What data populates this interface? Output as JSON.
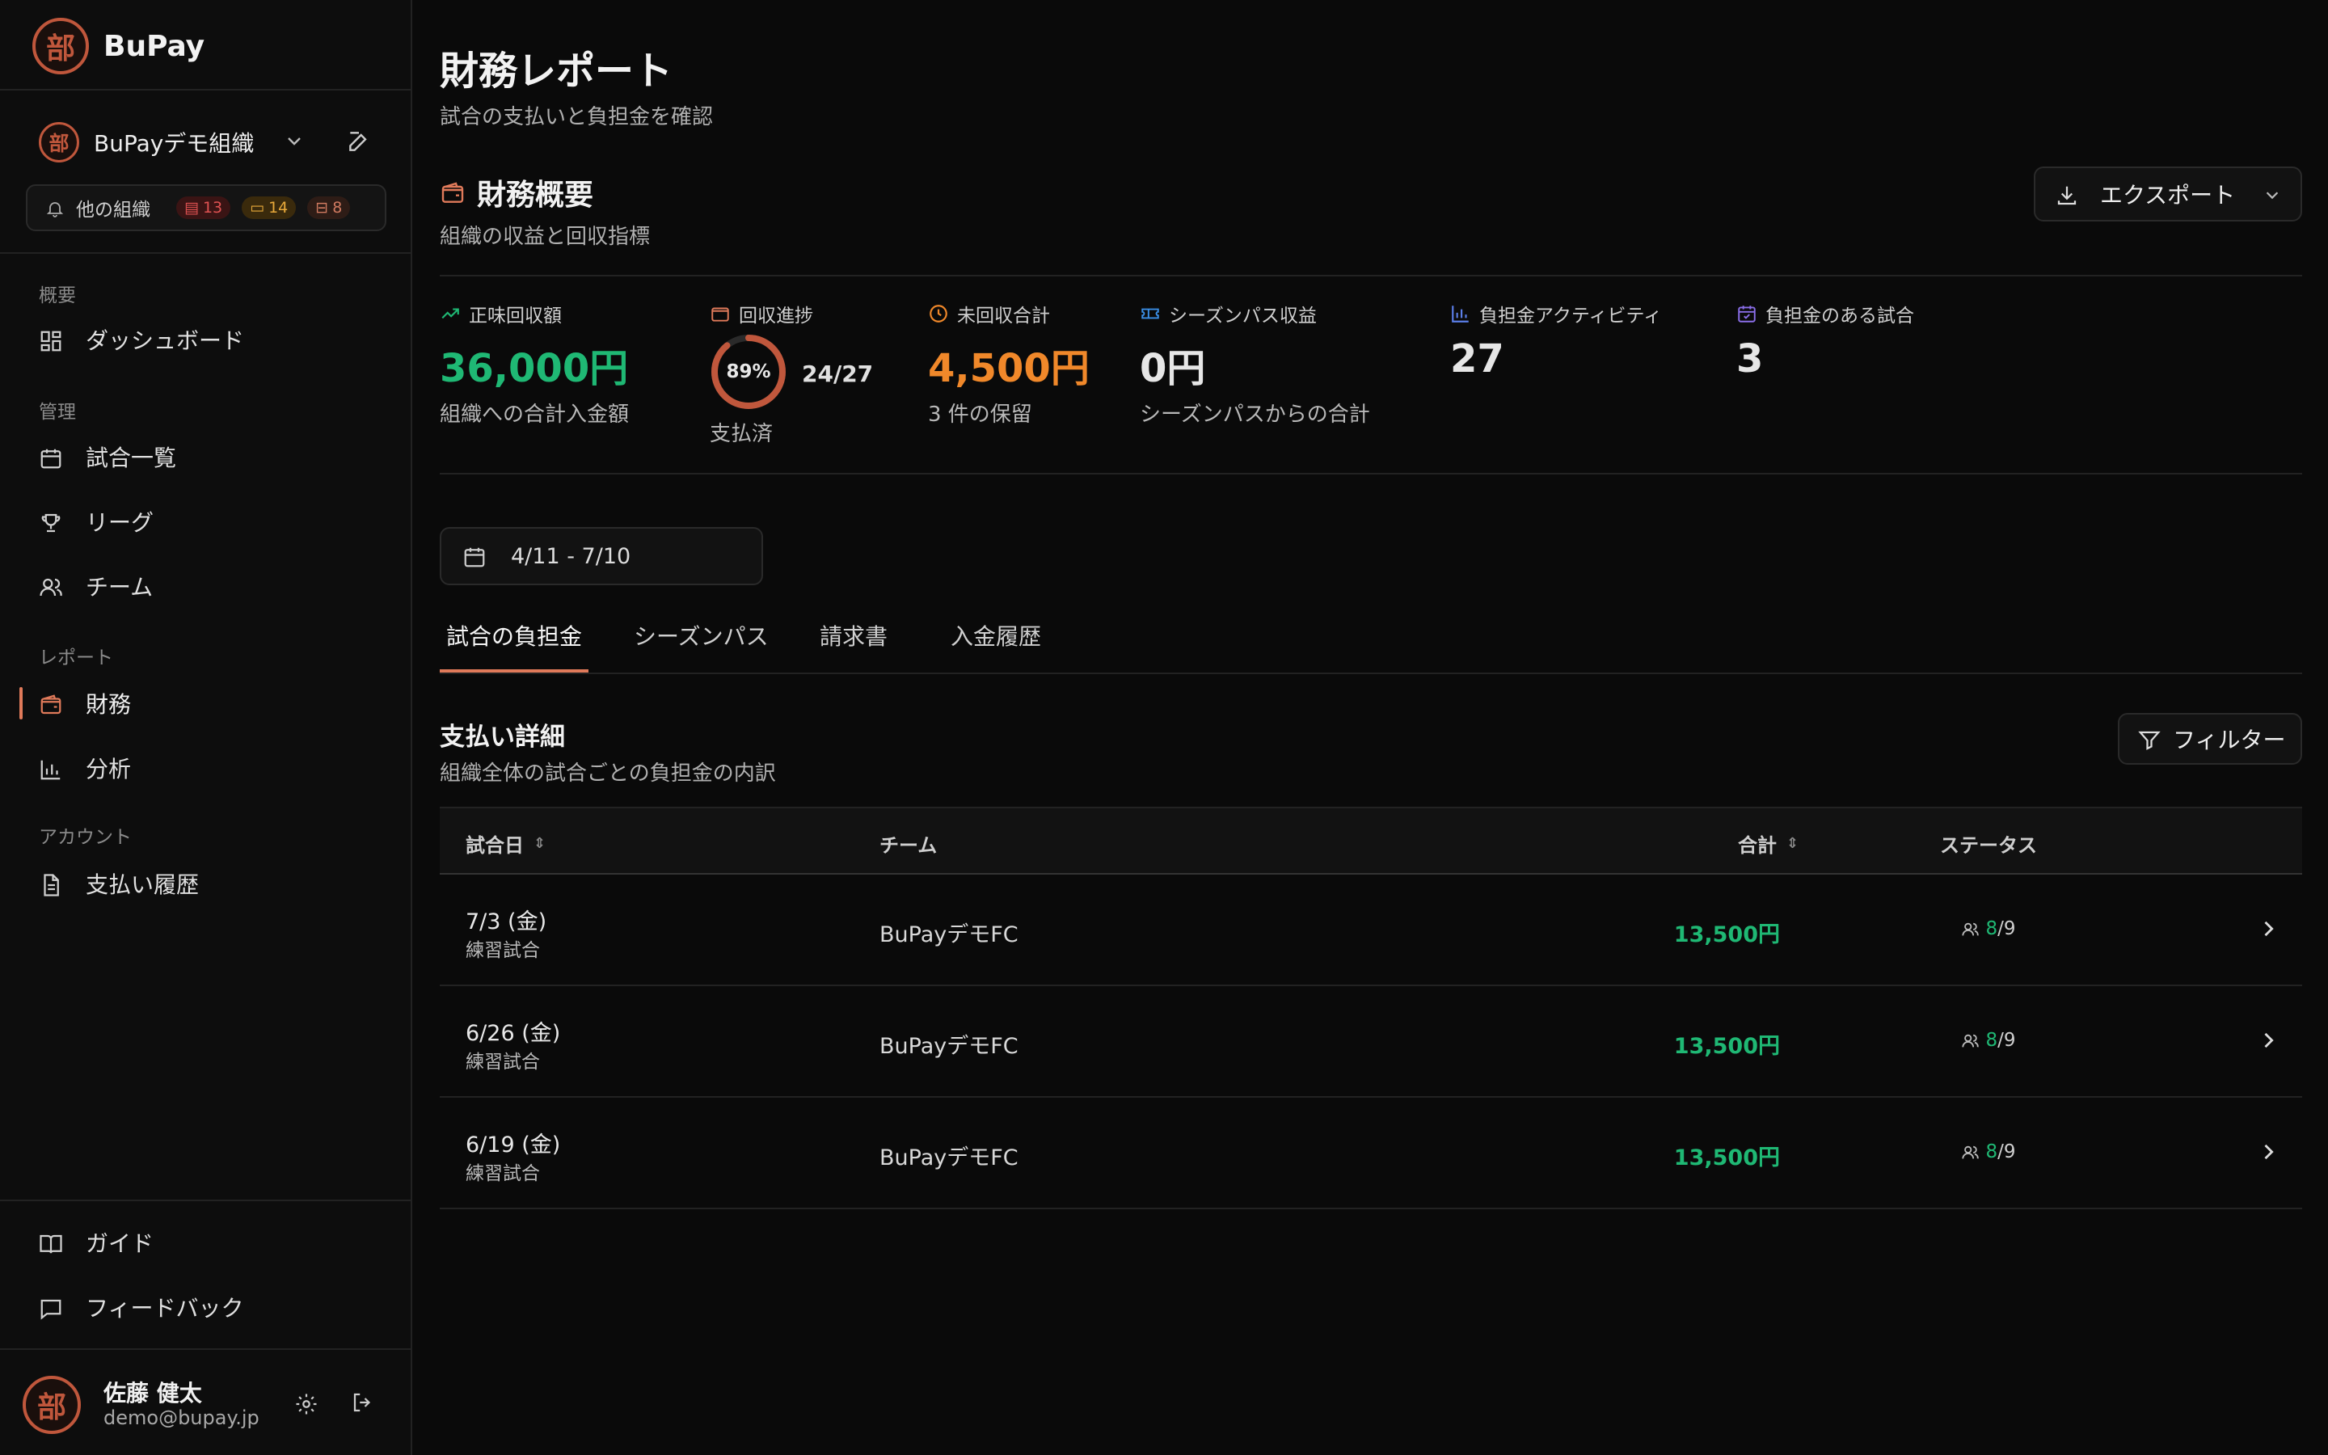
{
  "app": {
    "brand": "BuPay",
    "logo_char": "部"
  },
  "org": {
    "name": "BuPayデモ組織"
  },
  "other_orgs": {
    "label": "他の組織",
    "badges": {
      "red": "13",
      "amber": "14",
      "brown": "8"
    }
  },
  "sidebar": {
    "sections": {
      "overview": "概要",
      "manage": "管理",
      "report": "レポート",
      "account": "アカウント"
    },
    "items": {
      "dashboard": "ダッシュボード",
      "matches": "試合一覧",
      "leagues": "リーグ",
      "teams": "チーム",
      "finance": "財務",
      "analytics": "分析",
      "payments": "支払い履歴",
      "guide": "ガイド",
      "feedback": "フィードバック"
    }
  },
  "user": {
    "name": "佐藤 健太",
    "email": "demo@bupay.jp"
  },
  "page": {
    "title": "財務レポート",
    "subtitle": "試合の支払いと負担金を確認"
  },
  "overview": {
    "title": "財務概要",
    "subtitle": "組織の収益と回収指標",
    "export_label": "エクスポート"
  },
  "stats": {
    "net": {
      "label": "正味回収額",
      "value": "36,000円",
      "note": "組織への合計入金額"
    },
    "progress": {
      "label": "回収進捗",
      "percent": "89%",
      "fraction": 0.89,
      "count": "24/27",
      "note": "支払済"
    },
    "unpaid": {
      "label": "未回収合計",
      "value": "4,500円",
      "note": "3 件の保留"
    },
    "season": {
      "label": "シーズンパス収益",
      "value": "0円",
      "note": "シーズンパスからの合計"
    },
    "activity": {
      "label": "負担金アクティビティ",
      "value": "27"
    },
    "matches": {
      "label": "負担金のある試合",
      "value": "3"
    }
  },
  "date_range": "4/11 - 7/10",
  "tabs": [
    "試合の負担金",
    "シーズンパス",
    "請求書",
    "入金履歴"
  ],
  "details": {
    "title": "支払い詳細",
    "subtitle": "組織全体の試合ごとの負担金の内訳",
    "filter_label": "フィルター"
  },
  "table": {
    "headers": {
      "date": "試合日",
      "team": "チーム",
      "total": "合計",
      "status": "ステータス"
    },
    "rows": [
      {
        "date": "7/3 (金)",
        "type": "練習試合",
        "team": "BuPayデモFC",
        "total": "13,500円",
        "paid": "8",
        "total_count": "/9"
      },
      {
        "date": "6/26 (金)",
        "type": "練習試合",
        "team": "BuPayデモFC",
        "total": "13,500円",
        "paid": "8",
        "total_count": "/9"
      },
      {
        "date": "6/19 (金)",
        "type": "練習試合",
        "team": "BuPayデモFC",
        "total": "13,500円",
        "paid": "8",
        "total_count": "/9"
      }
    ]
  },
  "colors": {
    "accent": "#e07a5a",
    "green": "#1fb874",
    "orange": "#f0882a"
  }
}
